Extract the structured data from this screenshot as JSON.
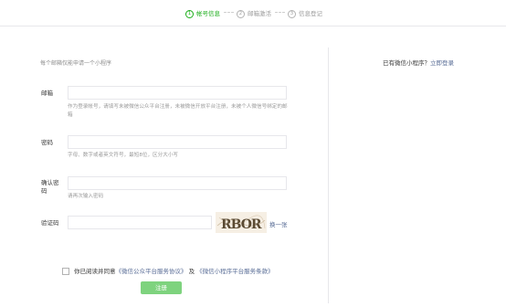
{
  "steps": [
    {
      "num": "1",
      "label": "帐号信息",
      "active": true
    },
    {
      "num": "2",
      "label": "邮箱激活",
      "active": false
    },
    {
      "num": "3",
      "label": "信息登记",
      "active": false
    }
  ],
  "form": {
    "hint": "每个邮箱仅能申请一个小程序",
    "email_label": "邮箱",
    "email_value": "",
    "email_tip": "作为登录帐号，请填写未被微信公众平台注册，未被微信开放平台注册，未被个人微信号绑定的邮箱",
    "password_label": "密码",
    "password_value": "",
    "password_tip": "字母、数字或者英文符号，最短8位，区分大小写",
    "confirm_label": "确认密码",
    "confirm_value": "",
    "confirm_tip": "请再次输入密码",
    "captcha_label": "验证码",
    "captcha_value": "",
    "captcha_text": "RBOR",
    "refresh_label": "换一张"
  },
  "side": {
    "prompt": "已有微信小程序？",
    "login_link": "立即登录"
  },
  "agreement": {
    "prefix": "你已阅读并同意",
    "link1": "《微信公众平台服务协议》",
    "middle": "及",
    "link2": "《微信小程序平台服务条款》"
  },
  "register_label": "注册",
  "colors": {
    "accent": "#1aad19",
    "link": "#576b95",
    "button_disabled": "#7ed37e"
  }
}
